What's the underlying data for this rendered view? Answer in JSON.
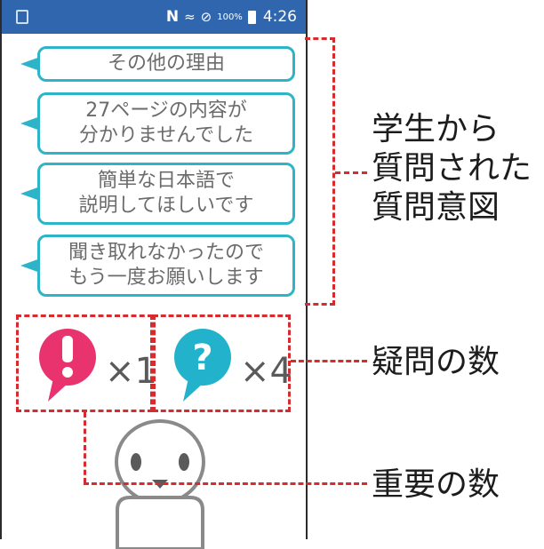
{
  "status_bar": {
    "n_label": "N",
    "battery_percent": "100%",
    "time": "4:26"
  },
  "bubbles": [
    {
      "lines": [
        "その他の理由"
      ]
    },
    {
      "lines": [
        "27ページの内容が",
        "分かりませんでした"
      ]
    },
    {
      "lines": [
        "簡単な日本語で",
        "説明してほしいです"
      ]
    },
    {
      "lines": [
        "聞き取れなかったので",
        "もう一度お願いします"
      ]
    }
  ],
  "counters": {
    "exclamation": {
      "label": "×1",
      "color": "#e8336f",
      "icon": "exclamation-bubble-icon"
    },
    "question": {
      "label": "×4",
      "color": "#23b2cc",
      "icon": "question-bubble-icon"
    }
  },
  "annotations": {
    "intent": [
      "学生から",
      "質問された",
      "質問意図"
    ],
    "questions": "疑問の数",
    "important": "重要の数"
  },
  "colors": {
    "status_bar": "#2f66ad",
    "bubble_border": "#2eb4c9",
    "annotation_dash": "#d62b2f"
  }
}
